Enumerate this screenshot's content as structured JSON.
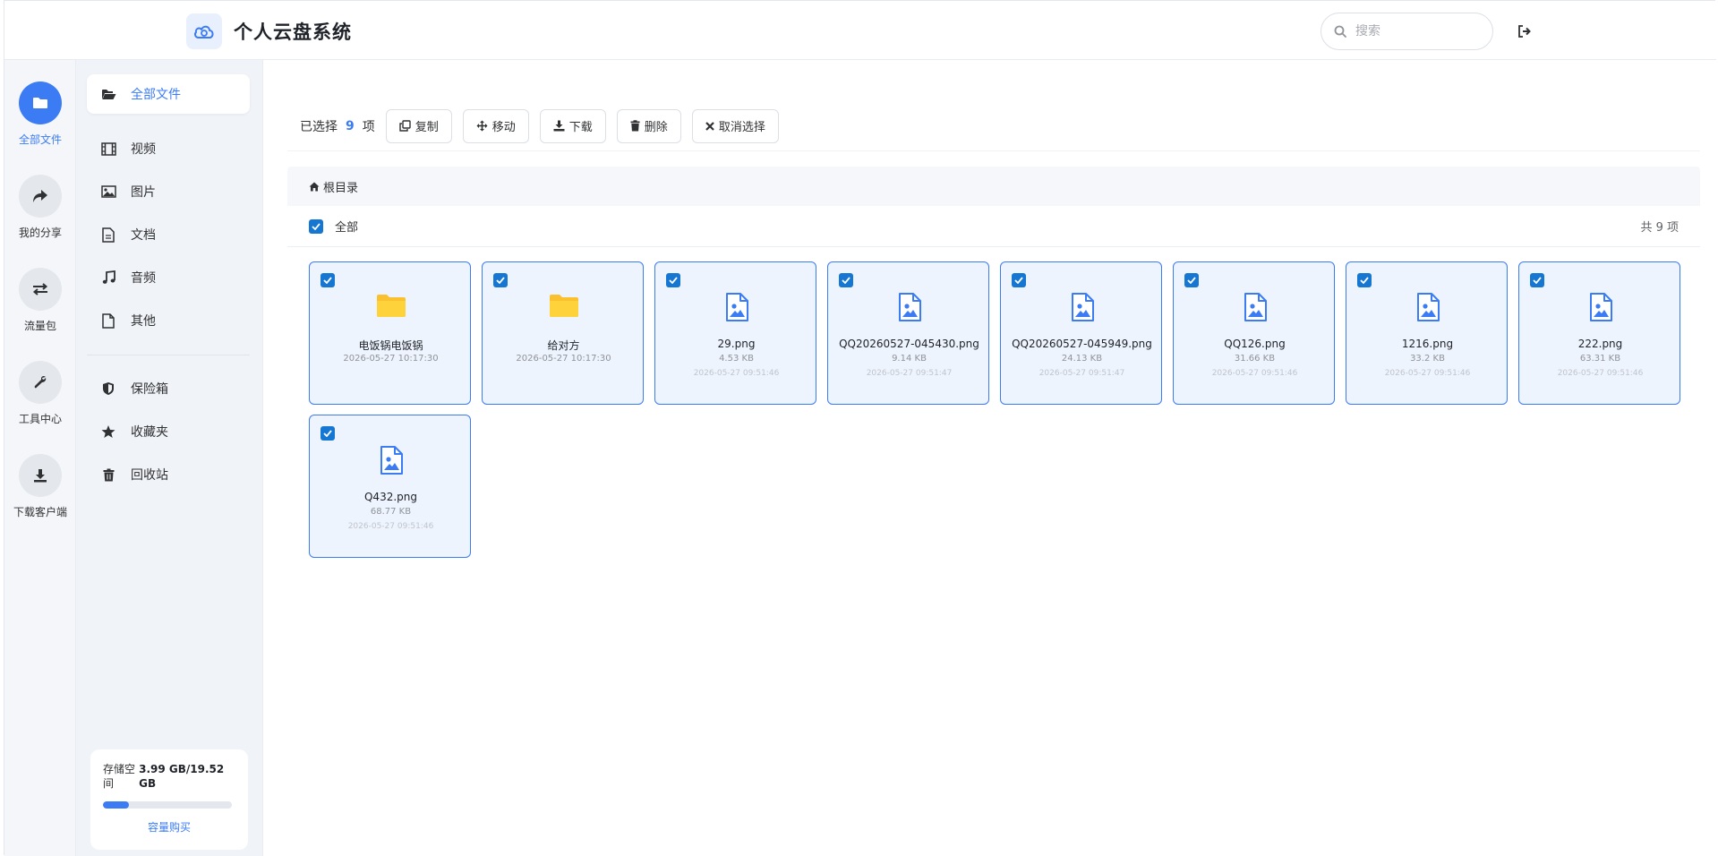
{
  "header": {
    "app_title": "个人云盘系统",
    "search_placeholder": "搜索"
  },
  "rail": [
    {
      "label": "全部文件",
      "icon": "folder-icon",
      "active": true
    },
    {
      "label": "我的分享",
      "icon": "share-icon",
      "active": false
    },
    {
      "label": "流量包",
      "icon": "exchange-icon",
      "active": false
    },
    {
      "label": "工具中心",
      "icon": "wrench-icon",
      "active": false
    },
    {
      "label": "下载客户端",
      "icon": "download-icon",
      "active": false
    }
  ],
  "sidebar": {
    "items": [
      {
        "label": "全部文件",
        "icon": "folder-open-icon",
        "active": true
      },
      {
        "label": "视频",
        "icon": "film-icon"
      },
      {
        "label": "图片",
        "icon": "image-icon"
      },
      {
        "label": "文档",
        "icon": "document-icon"
      },
      {
        "label": "音频",
        "icon": "music-icon"
      },
      {
        "label": "其他",
        "icon": "file-icon"
      },
      {
        "label": "保险箱",
        "icon": "shield-icon"
      },
      {
        "label": "收藏夹",
        "icon": "star-icon"
      },
      {
        "label": "回收站",
        "icon": "trash-icon"
      }
    ],
    "storage": {
      "label": "存储空间",
      "value": "3.99 GB/19.52 GB",
      "used_fraction": 0.204,
      "buy_label": "容量购买"
    }
  },
  "toolbar": {
    "selected_prefix": "已选择",
    "selected_count": "9",
    "selected_suffix": "项",
    "copy_label": "复制",
    "move_label": "移动",
    "download_label": "下载",
    "delete_label": "删除",
    "cancel_label": "取消选择"
  },
  "breadcrumb": {
    "root": "根目录"
  },
  "list_header": {
    "all_label": "全部",
    "total": "共 9 项"
  },
  "files": [
    {
      "name": "电饭锅电饭锅",
      "type": "folder",
      "meta": "2026-05-27 10:17:30",
      "date": ""
    },
    {
      "name": "给对方",
      "type": "folder",
      "meta": "2026-05-27 10:17:30",
      "date": ""
    },
    {
      "name": "29.png",
      "type": "image",
      "meta": "4.53 KB",
      "date": "2026-05-27 09:51:46"
    },
    {
      "name": "QQ20260527-045430.png",
      "type": "image",
      "meta": "9.14 KB",
      "date": "2026-05-27 09:51:47"
    },
    {
      "name": "QQ20260527-045949.png",
      "type": "image",
      "meta": "24.13 KB",
      "date": "2026-05-27 09:51:47"
    },
    {
      "name": "QQ126.png",
      "type": "image",
      "meta": "31.66 KB",
      "date": "2026-05-27 09:51:46"
    },
    {
      "name": "1216.png",
      "type": "image",
      "meta": "33.2 KB",
      "date": "2026-05-27 09:51:46"
    },
    {
      "name": "222.png",
      "type": "image",
      "meta": "63.31 KB",
      "date": "2026-05-27 09:51:46"
    },
    {
      "name": "Q432.png",
      "type": "image",
      "meta": "68.77 KB",
      "date": "2026-05-27 09:51:46"
    }
  ],
  "colors": {
    "accent": "#3b7cf4",
    "folder": "#fbc02d",
    "checkbox": "#1677d2"
  }
}
